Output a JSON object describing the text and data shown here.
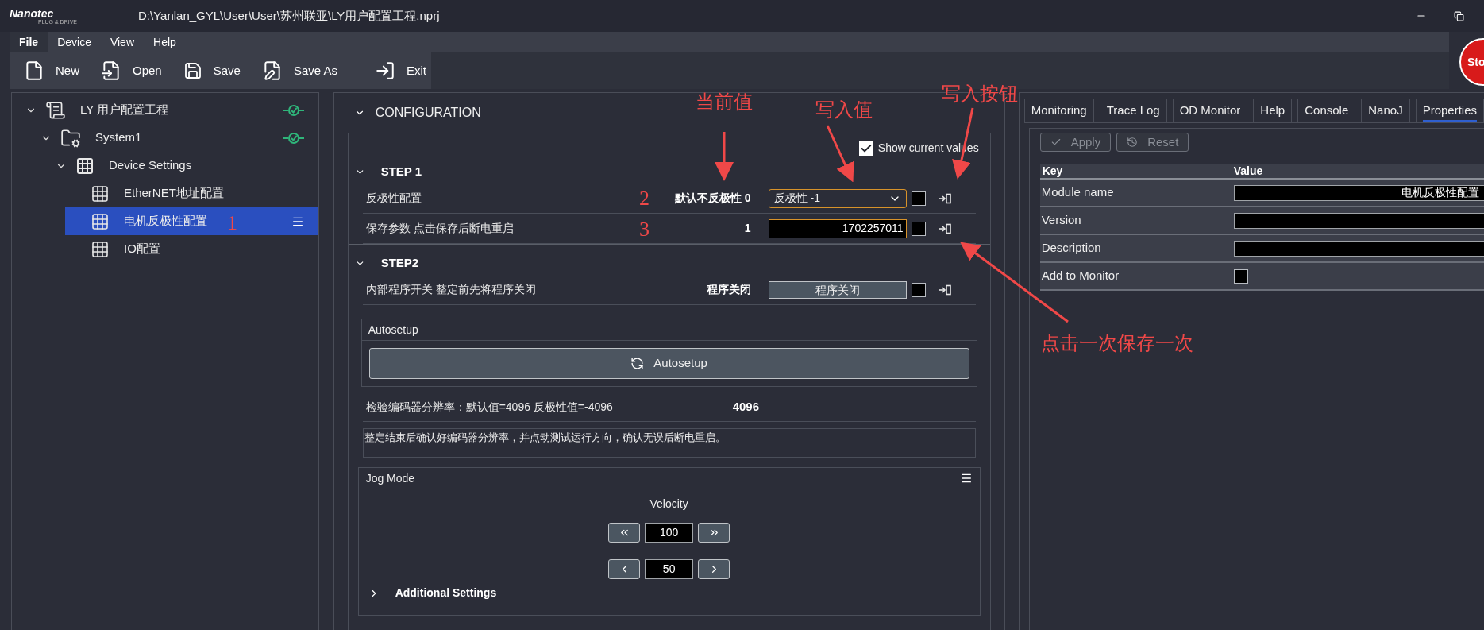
{
  "window": {
    "title": "D:\\Yanlan_GYL\\User\\User\\苏州联亚\\LY用户配置工程.nprj"
  },
  "logo": {
    "name": "Nanotec",
    "tagline": "PLUG & DRIVE"
  },
  "stop_button": {
    "label": "Sto"
  },
  "menu": [
    {
      "label": "File",
      "selected": true
    },
    {
      "label": "Device",
      "selected": false
    },
    {
      "label": "View",
      "selected": false
    },
    {
      "label": "Help",
      "selected": false
    }
  ],
  "toolbar": [
    {
      "label": "New",
      "kind": "new"
    },
    {
      "label": "Open",
      "kind": "open"
    },
    {
      "label": "Save",
      "kind": "save"
    },
    {
      "label": "Save As",
      "kind": "saveas"
    },
    {
      "label": "Exit",
      "kind": "exit"
    }
  ],
  "tree": [
    {
      "label": "LY 用户配置工程",
      "kind": "project",
      "expanded": true,
      "connected": true,
      "selected": false,
      "children": [
        {
          "label": "System1",
          "kind": "system",
          "expanded": true,
          "connected": true,
          "selected": false,
          "children": [
            {
              "label": "Device Settings",
              "kind": "group",
              "expanded": true,
              "connected": false,
              "selected": false,
              "children": [
                {
                  "label": "EtherNET地址配置",
                  "kind": "module",
                  "connected": false,
                  "selected": false
                },
                {
                  "label": "电机反极性配置",
                  "kind": "module",
                  "connected": false,
                  "selected": true
                },
                {
                  "label": "IO配置",
                  "kind": "module",
                  "connected": false,
                  "selected": false
                }
              ]
            }
          ]
        }
      ]
    }
  ],
  "config": {
    "title": "CONFIGURATION",
    "expanded": true,
    "show_current_values": {
      "label": "Show current values",
      "checked": true
    },
    "steps": [
      {
        "title": "STEP 1",
        "expanded": true,
        "items": [
          {
            "kind": "parameter",
            "label": "反极性配置",
            "current": "默认不反极性 0",
            "control": {
              "kind": "dropdown",
              "value": "反极性 -1"
            },
            "checked": false
          },
          {
            "kind": "parameter",
            "label": "保存参数 点击保存后断电重启",
            "current": "1",
            "control": {
              "kind": "input",
              "value": "1702257011"
            },
            "checked": false
          }
        ]
      },
      {
        "title": "STEP2",
        "expanded": true,
        "items": [
          {
            "kind": "parameter",
            "label": "内部程序开关 整定前先将程序关闭",
            "current": "程序关闭",
            "control": {
              "kind": "button",
              "value": "程序关闭"
            },
            "checked": false
          },
          {
            "kind": "autosetup",
            "title": "Autosetup",
            "button": "Autosetup"
          },
          {
            "kind": "reading",
            "label": "检验编码器分辨率：默认值=4096 反极性值=-4096",
            "value": "4096"
          },
          {
            "kind": "note",
            "text": "整定结束后确认好编码器分辨率，并点动测试运行方向，确认无误后断电重启。"
          },
          {
            "kind": "jog",
            "title": "Jog Mode",
            "velocity_label": "Velocity",
            "rows": [
              {
                "kind": "coarse",
                "value": "100"
              },
              {
                "kind": "fine",
                "value": "50"
              }
            ],
            "additional": {
              "label": "Additional Settings",
              "expanded": false
            }
          }
        ]
      }
    ]
  },
  "right_panel": {
    "tabs": [
      {
        "label": "Monitoring",
        "selected": false
      },
      {
        "label": "Trace Log",
        "selected": false
      },
      {
        "label": "OD Monitor",
        "selected": false
      },
      {
        "label": "Help",
        "selected": false
      },
      {
        "label": "Console",
        "selected": false
      },
      {
        "label": "NanoJ",
        "selected": false
      },
      {
        "label": "Properties",
        "selected": true
      }
    ],
    "buttons": [
      {
        "label": "Apply",
        "kind": "apply",
        "disabled": true
      },
      {
        "label": "Reset",
        "kind": "reset",
        "disabled": true
      }
    ],
    "table": {
      "columns": [
        "Key",
        "Value"
      ],
      "rows": [
        {
          "key": "Module name",
          "kind": "text",
          "value": "电机反极性配置"
        },
        {
          "key": "Version",
          "kind": "text",
          "value": ""
        },
        {
          "key": "Description",
          "kind": "text",
          "value": ""
        },
        {
          "key": "Add to Monitor",
          "kind": "checkbox",
          "checked": false
        }
      ]
    }
  },
  "annotations": [
    {
      "kind": "callout",
      "text": "当前值"
    },
    {
      "kind": "callout",
      "text": "写入值"
    },
    {
      "kind": "callout",
      "text": "写入按钮"
    },
    {
      "kind": "callout",
      "text": "点击一次保存一次"
    },
    {
      "kind": "number",
      "text": "1"
    },
    {
      "kind": "number",
      "text": "2"
    },
    {
      "kind": "number",
      "text": "3"
    }
  ]
}
